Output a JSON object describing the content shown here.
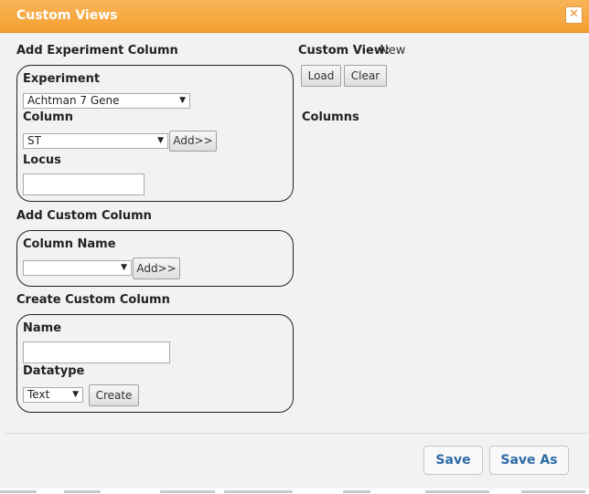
{
  "dialog": {
    "title": "Custom Views",
    "close_icon": "close-x-icon"
  },
  "add_experiment": {
    "heading": "Add Experiment Column",
    "experiment_label": "Experiment",
    "experiment_value": "Achtman 7 Gene",
    "column_label": "Column",
    "column_value": "ST",
    "add_label": "Add>>",
    "locus_label": "Locus",
    "locus_value": ""
  },
  "add_custom": {
    "heading": "Add Custom Column",
    "column_name_label": "Column Name",
    "column_name_value": "",
    "add_label": "Add>>"
  },
  "create_custom": {
    "heading": "Create Custom Column",
    "name_label": "Name",
    "name_value": "",
    "datatype_label": "Datatype",
    "datatype_value": "Text",
    "create_label": "Create"
  },
  "custom_view": {
    "label": "Custom View:",
    "value": "New",
    "load_label": "Load",
    "clear_label": "Clear",
    "columns_label": "Columns"
  },
  "footer": {
    "save_label": "Save",
    "save_as_label": "Save As"
  },
  "colors": {
    "titlebar": "#f4a030",
    "accent_text": "#2b6aa6",
    "panel": "#f2f2f2"
  }
}
